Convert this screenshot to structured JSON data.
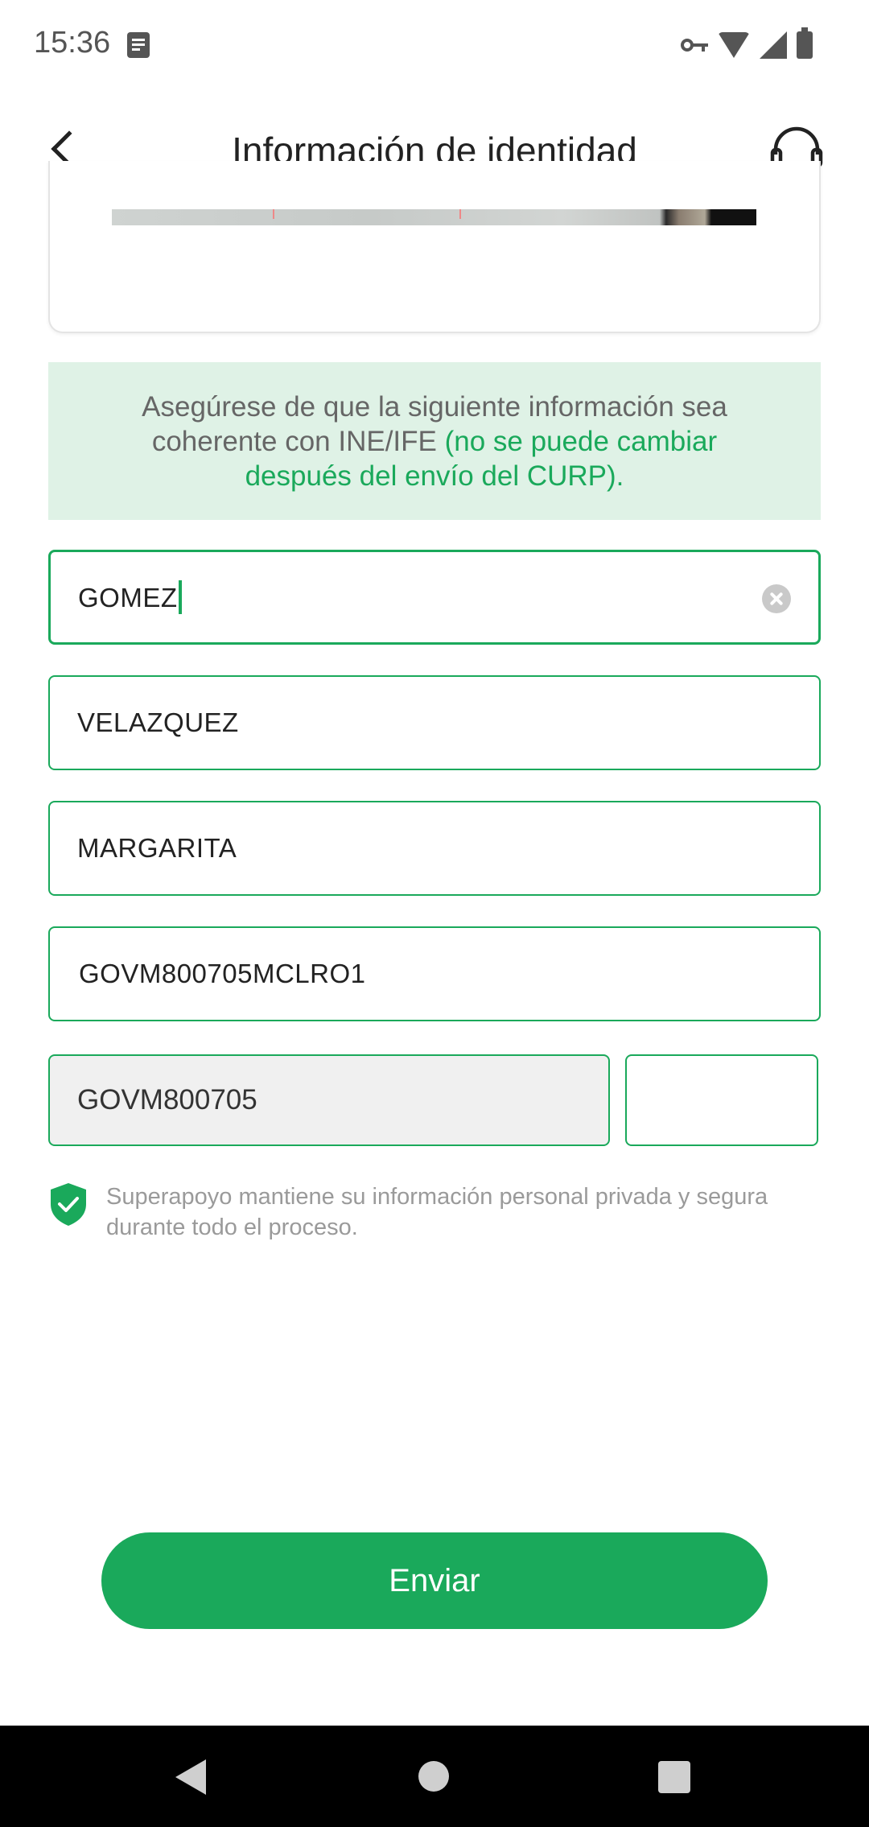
{
  "status_bar": {
    "time": "15:36",
    "icons": [
      "notification-icon",
      "vpn-key-icon",
      "wifi-icon",
      "signal-icon",
      "battery-icon"
    ]
  },
  "app_bar": {
    "title": "Información de identidad",
    "back_icon": "back-chevron-icon",
    "support_icon": "headset-icon"
  },
  "info_banner": {
    "text": "Asegúrese de que la siguiente información sea coherente con INE/IFE",
    "highlight": "(no se puede cambiar después del envío del CURP)."
  },
  "form": {
    "paternal_surname": "GOMEZ",
    "maternal_surname": "VELAZQUEZ",
    "given_name": "MARGARITA",
    "curp_full": "GOVM800705MCLRO1",
    "curp_prefix": "GOVM800705",
    "curp_suffix": ""
  },
  "privacy_note": {
    "icon": "shield-check-icon",
    "text": "Superapoyo mantiene su información personal privada y segura durante todo el proceso."
  },
  "submit": {
    "label": "Enviar"
  },
  "colors": {
    "accent": "#1aa95b",
    "banner_bg": "#dff2e6"
  }
}
